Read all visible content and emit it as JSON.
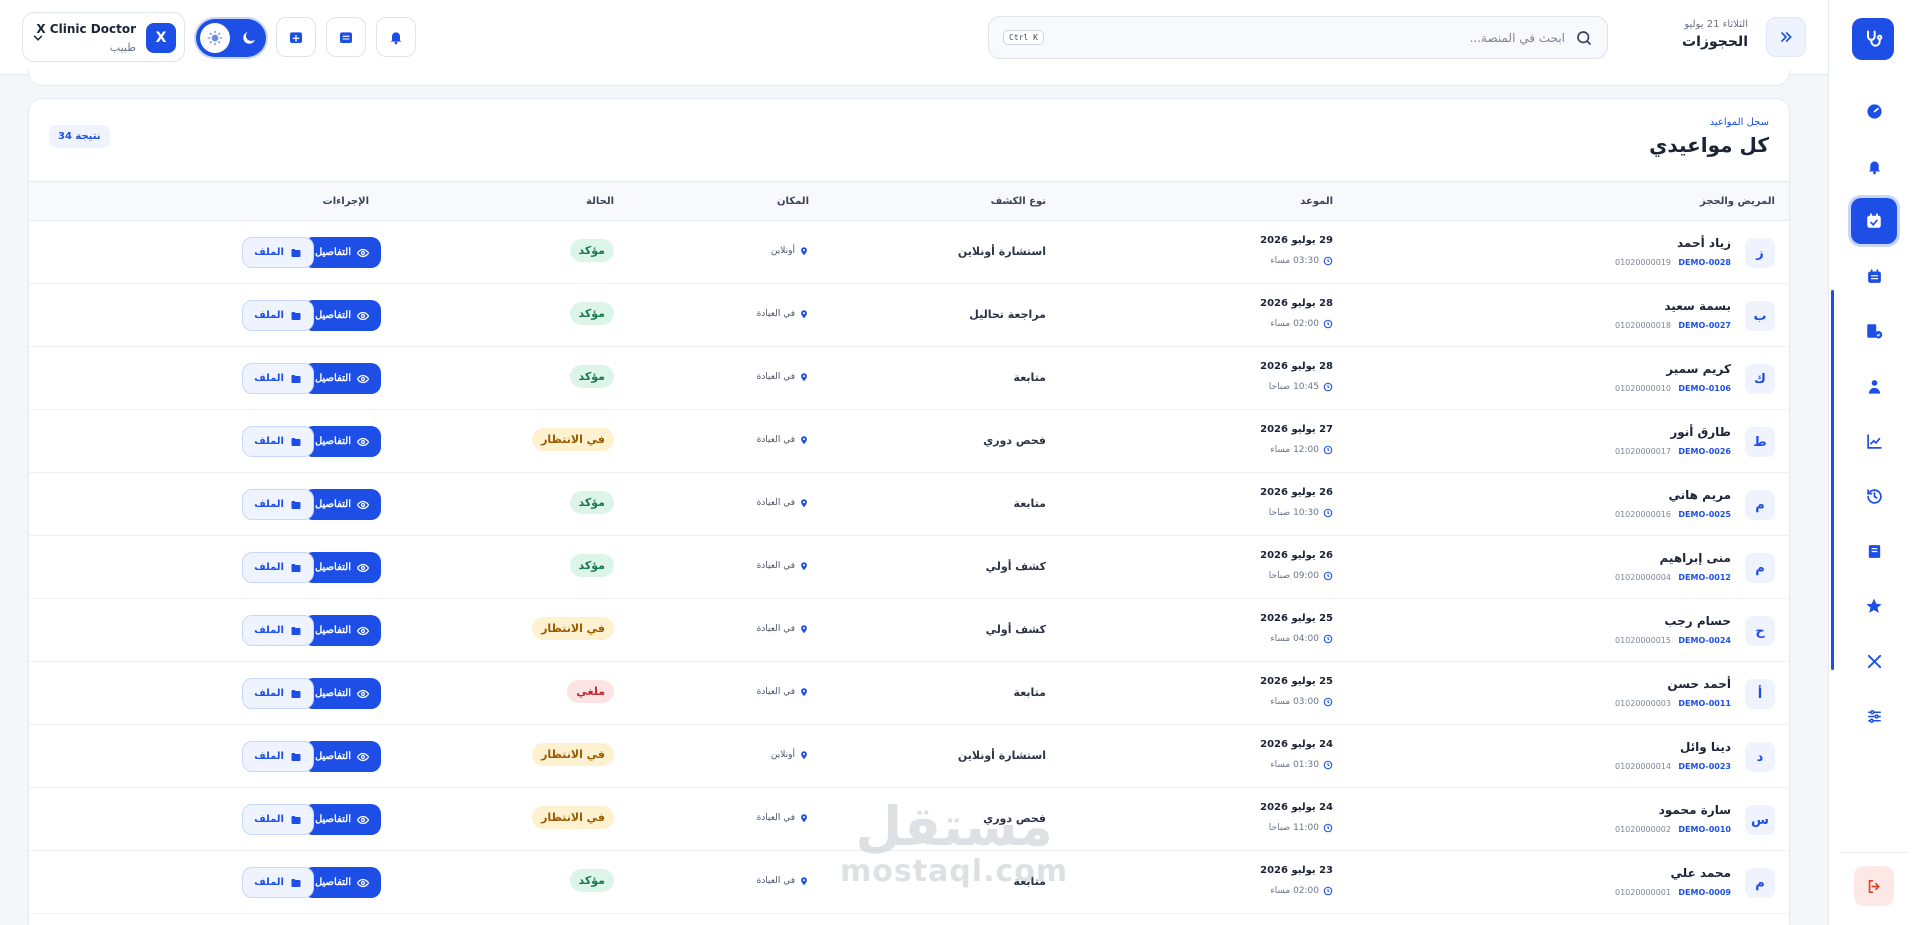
{
  "header": {
    "date": "الثلاثاء 21 يوليو",
    "title": "الحجوزات",
    "search_placeholder": "ابحث في المنصة...",
    "search_shortcut": "Ctrl K",
    "user": {
      "initial": "X",
      "name": "X Clinic Doctor",
      "role": "طبيب"
    }
  },
  "card": {
    "subtitle": "سجل المواعيد",
    "title": "كل مواعيدي",
    "results": "34 نتيجة"
  },
  "columns": {
    "patient": "المريض والحجز",
    "appointment": "الموعد",
    "type": "نوع الكشف",
    "location": "المكان",
    "status": "الحالة",
    "actions": "الإجراءات"
  },
  "actions": {
    "details": "التفاصيل",
    "file": "الملف"
  },
  "rows": [
    {
      "initial": "ز",
      "name": "زياد أحمد",
      "code": "DEMO-0028",
      "phone": "01020000019",
      "date": "29 يوليو 2026",
      "time": "03:30 مساء",
      "type": "استشارة أونلاين",
      "location": "أونلاين",
      "status": "مؤكد",
      "status_kind": "ok"
    },
    {
      "initial": "ب",
      "name": "بسمة سعيد",
      "code": "DEMO-0027",
      "phone": "01020000018",
      "date": "28 يوليو 2026",
      "time": "02:00 مساء",
      "type": "مراجعة تحاليل",
      "location": "في العيادة",
      "status": "مؤكد",
      "status_kind": "ok"
    },
    {
      "initial": "ك",
      "name": "كريم سمير",
      "code": "DEMO-0106",
      "phone": "01020000010",
      "date": "28 يوليو 2026",
      "time": "10:45 صباحا",
      "type": "متابعة",
      "location": "في العيادة",
      "status": "مؤكد",
      "status_kind": "ok"
    },
    {
      "initial": "ط",
      "name": "طارق أنور",
      "code": "DEMO-0026",
      "phone": "01020000017",
      "date": "27 يوليو 2026",
      "time": "12:00 مساء",
      "type": "فحص دوري",
      "location": "في العيادة",
      "status": "في الانتظار",
      "status_kind": "wait"
    },
    {
      "initial": "م",
      "name": "مريم هاني",
      "code": "DEMO-0025",
      "phone": "01020000016",
      "date": "26 يوليو 2026",
      "time": "10:30 صباحا",
      "type": "متابعة",
      "location": "في العيادة",
      "status": "مؤكد",
      "status_kind": "ok"
    },
    {
      "initial": "م",
      "name": "منى إبراهيم",
      "code": "DEMO-0012",
      "phone": "01020000004",
      "date": "26 يوليو 2026",
      "time": "09:00 صباحا",
      "type": "كشف أولي",
      "location": "في العيادة",
      "status": "مؤكد",
      "status_kind": "ok"
    },
    {
      "initial": "ح",
      "name": "حسام رجب",
      "code": "DEMO-0024",
      "phone": "01020000015",
      "date": "25 يوليو 2026",
      "time": "04:00 مساء",
      "type": "كشف أولي",
      "location": "في العيادة",
      "status": "في الانتظار",
      "status_kind": "wait"
    },
    {
      "initial": "أ",
      "name": "أحمد حسن",
      "code": "DEMO-0011",
      "phone": "01020000003",
      "date": "25 يوليو 2026",
      "time": "03:00 مساء",
      "type": "متابعة",
      "location": "في العيادة",
      "status": "ملغي",
      "status_kind": "cancel"
    },
    {
      "initial": "د",
      "name": "دينا وائل",
      "code": "DEMO-0023",
      "phone": "01020000014",
      "date": "24 يوليو 2026",
      "time": "01:30 مساء",
      "type": "استشارة أونلاين",
      "location": "أونلاين",
      "status": "في الانتظار",
      "status_kind": "wait"
    },
    {
      "initial": "س",
      "name": "سارة محمود",
      "code": "DEMO-0010",
      "phone": "01020000002",
      "date": "24 يوليو 2026",
      "time": "11:00 صباحا",
      "type": "فحص دوري",
      "location": "في العيادة",
      "status": "في الانتظار",
      "status_kind": "wait"
    },
    {
      "initial": "م",
      "name": "محمد علي",
      "code": "DEMO-0009",
      "phone": "01020000001",
      "date": "23 يوليو 2026",
      "time": "02:00 مساء",
      "type": "متابعة",
      "location": "في العيادة",
      "status": "مؤكد",
      "status_kind": "ok"
    }
  ],
  "watermark": {
    "arabic": "مستقل",
    "latin": "mostaql.com"
  },
  "colors": {
    "accent": "#1d4fe6",
    "confirmed": "#18794e",
    "pending": "#9a5a00",
    "cancelled": "#c0262d"
  }
}
